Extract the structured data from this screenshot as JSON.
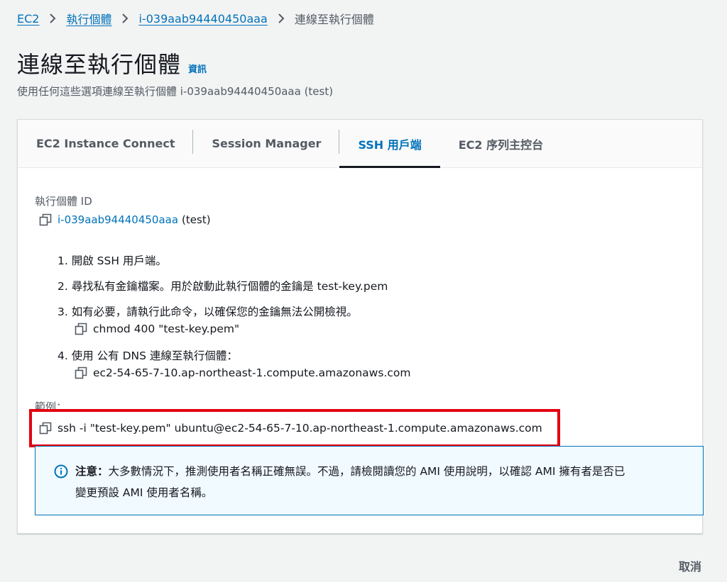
{
  "breadcrumb": {
    "items": [
      "EC2",
      "執行個體",
      "i-039aab94440450aaa"
    ],
    "current": "連線至執行個體"
  },
  "header": {
    "title": "連線至執行個體",
    "info_link": "資訊",
    "description": "使用任何這些選項連線至執行個體 i-039aab94440450aaa (test)"
  },
  "tabs": [
    {
      "label": "EC2 Instance Connect"
    },
    {
      "label": "Session Manager"
    },
    {
      "label": "SSH 用戶端"
    },
    {
      "label": "EC2 序列主控台"
    }
  ],
  "instance": {
    "label": "執行個體 ID",
    "id": "i-039aab94440450aaa",
    "name": "(test)"
  },
  "steps": [
    "1. 開啟 SSH 用戶端。",
    "2. 尋找私有金鑰檔案。用於啟動此執行個體的金鑰是 test-key.pem",
    "3. 如有必要，請執行此命令，以確保您的金鑰無法公開檢視。",
    "4. 使用 公有 DNS 連線至執行個體："
  ],
  "commands": {
    "chmod": "chmod 400 \"test-key.pem\"",
    "dns": "ec2-54-65-7-10.ap-northeast-1.compute.amazonaws.com"
  },
  "example": {
    "label": "範例：",
    "command": "ssh -i \"test-key.pem\" ubuntu@ec2-54-65-7-10.ap-northeast-1.compute.amazonaws.com"
  },
  "alert": {
    "bold": "注意：",
    "line1": "大多數情況下，推測使用者名稱正確無誤。不過，請檢閱讀您的 AMI 使用說明，以確認 AMI 擁有者是否已",
    "line2": "變更預設 AMI 使用者名稱。"
  },
  "footer": {
    "cancel_label": "取消"
  },
  "colors": {
    "link": "#0073bb",
    "highlight": "#e4000f",
    "alert_bg": "#f1faff"
  }
}
